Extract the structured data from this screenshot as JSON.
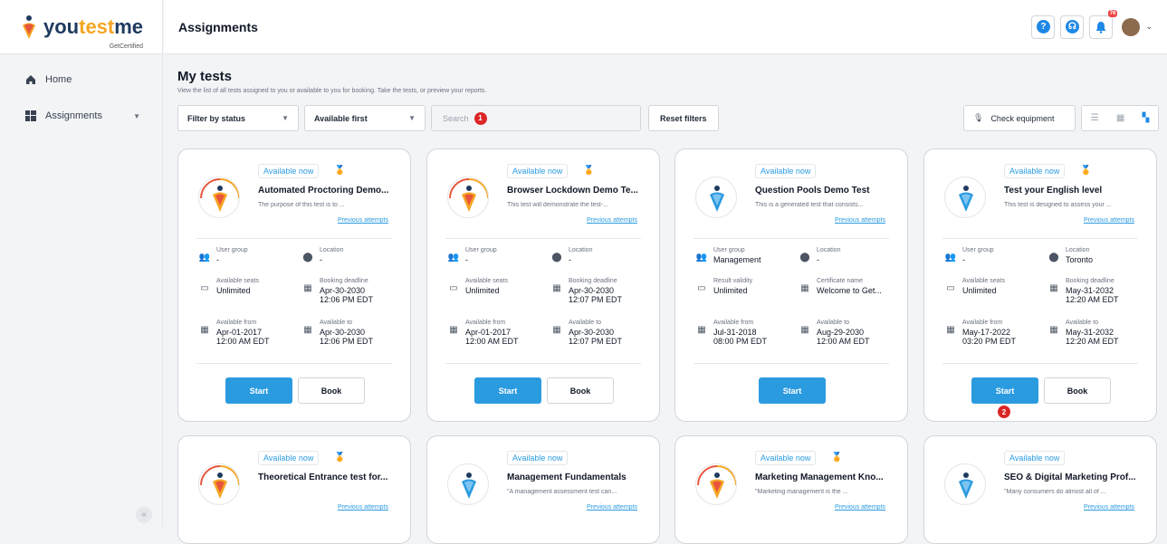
{
  "app": {
    "logo_text_a": "you",
    "logo_text_b": "test",
    "logo_text_c": "me",
    "logo_sub": "GetCertified"
  },
  "sidebar": {
    "items": [
      {
        "label": "Home",
        "icon": "home-icon"
      },
      {
        "label": "Assignments",
        "icon": "assignments-icon"
      }
    ],
    "collapse": "«"
  },
  "topbar": {
    "title": "Assignments",
    "notif_count": "76",
    "help": "?"
  },
  "page": {
    "title": "My tests",
    "subtitle": "View the list of all tests assigned to you or available to you for booking. Take the tests, or preview your reports."
  },
  "filters": {
    "status": "Filter by status",
    "order": "Available first",
    "search_placeholder": "Search",
    "search_badge": "1",
    "reset": "Reset filters",
    "check_equipment": "Check equipment"
  },
  "tests": [
    {
      "status": "Available now",
      "title": "Automated Proctoring Demo...",
      "desc": "The purpose of this test is to ...",
      "prev": "Previous attempts",
      "f1l": "User group",
      "f1v": "-",
      "f2l": "Location",
      "f2v": "-",
      "f3l": "Available seats",
      "f3v": "Unlimited",
      "f4l": "Booking deadline",
      "f4v": "Apr-30-2030",
      "f4v2": "12:06 PM EDT",
      "f5l": "Available from",
      "f5v": "Apr-01-2017",
      "f5v2": "12:00 AM EDT",
      "f6l": "Available to",
      "f6v": "Apr-30-2030",
      "f6v2": "12:06 PM EDT",
      "start": "Start",
      "book": "Book"
    },
    {
      "status": "Available now",
      "title": "Browser Lockdown Demo Te...",
      "desc": "This test will demonstrate the test-...",
      "prev": "Previous attempts",
      "f1l": "User group",
      "f1v": "-",
      "f2l": "Location",
      "f2v": "-",
      "f3l": "Available seats",
      "f3v": "Unlimited",
      "f4l": "Booking deadline",
      "f4v": "Apr-30-2030",
      "f4v2": "12:07 PM EDT",
      "f5l": "Available from",
      "f5v": "Apr-01-2017",
      "f5v2": "12:00 AM EDT",
      "f6l": "Available to",
      "f6v": "Apr-30-2030",
      "f6v2": "12:07 PM EDT",
      "start": "Start",
      "book": "Book"
    },
    {
      "status": "Available now",
      "title": "Question Pools Demo Test",
      "desc": "This is a generated test that consists...",
      "prev": "Previous attempts",
      "f1l": "User group",
      "f1v": "Management",
      "f2l": "Location",
      "f2v": "-",
      "f3l": "Result validity",
      "f3v": "Unlimited",
      "f4l": "Certificate name",
      "f4v": "Welcome to Get...",
      "f4v2": "",
      "f5l": "Available from",
      "f5v": "Jul-31-2018",
      "f5v2": "08:00 PM EDT",
      "f6l": "Available to",
      "f6v": "Aug-29-2030",
      "f6v2": "12:00 AM EDT",
      "start": "Start",
      "book": ""
    },
    {
      "status": "Available now",
      "title": "Test your English level",
      "desc": "This test is designed to assess your ...",
      "prev": "Previous attempts",
      "f1l": "User group",
      "f1v": "-",
      "f2l": "Location",
      "f2v": "Toronto",
      "f3l": "Available seats",
      "f3v": "Unlimited",
      "f4l": "Booking deadline",
      "f4v": "May-31-2032",
      "f4v2": "12:20 AM EDT",
      "f5l": "Available from",
      "f5v": "May-17-2022",
      "f5v2": "03:20 PM EDT",
      "f6l": "Available to",
      "f6v": "May-31-2032",
      "f6v2": "12:20 AM EDT",
      "start": "Start",
      "book": "Book",
      "badge": "2"
    }
  ],
  "tests2": [
    {
      "status": "Available now",
      "title": "Theoretical Entrance test for...",
      "desc": "",
      "prev": "Previous attempts"
    },
    {
      "status": "Available now",
      "title": "Management Fundamentals",
      "desc": "\"A management assessment test can...",
      "prev": "Previous attempts"
    },
    {
      "status": "Available now",
      "title": "Marketing Management Kno...",
      "desc": "\"Marketing management is the ...",
      "prev": "Previous attempts"
    },
    {
      "status": "Available now",
      "title": "SEO & Digital Marketing Prof...",
      "desc": "\"Many consumers do almost all of ...",
      "prev": "Previous attempts"
    }
  ]
}
